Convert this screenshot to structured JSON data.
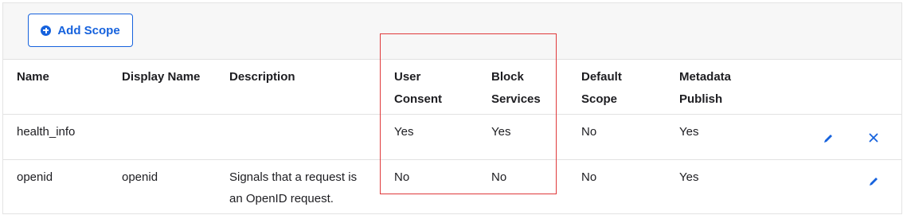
{
  "toolbar": {
    "add_scope_label": "Add Scope"
  },
  "table": {
    "headers": {
      "name": "Name",
      "display_name": "Display Name",
      "description": "Description",
      "user_consent_1": "User",
      "user_consent_2": "Consent",
      "block_services_1": "Block",
      "block_services_2": "Services",
      "default_scope_1": "Default",
      "default_scope_2": "Scope",
      "metadata_publish_1": "Metadata",
      "metadata_publish_2": "Publish"
    },
    "rows": [
      {
        "name": "health_info",
        "display_name": "",
        "description_1": "",
        "description_2": "",
        "user_consent": "Yes",
        "block_services": "Yes",
        "default_scope": "No",
        "metadata_publish": "Yes",
        "actions": [
          "edit-icon",
          "close-icon"
        ]
      },
      {
        "name": "openid",
        "display_name": "openid",
        "description_1": "Signals that a request is",
        "description_2": "an OpenID request.",
        "user_consent": "No",
        "block_services": "No",
        "default_scope": "No",
        "metadata_publish": "Yes",
        "actions": [
          "edit-icon"
        ]
      }
    ]
  },
  "colors": {
    "accent": "#1662dd",
    "highlight_border": "#e0393b",
    "toolbar_bg": "#f7f7f7"
  }
}
